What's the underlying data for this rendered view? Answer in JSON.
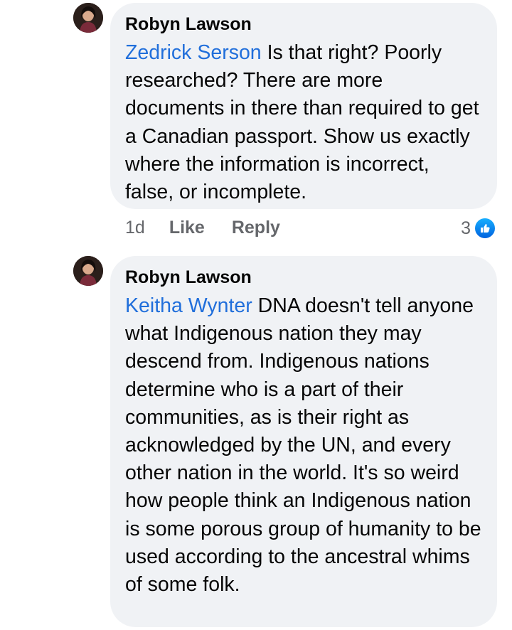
{
  "comments": [
    {
      "author": "Robyn Lawson",
      "mention": "Zedrick Serson",
      "text": " Is that right? Poorly researched? There are more documents in there than required to get a Canadian passport. Show us exactly where the information is incorrect, false, or incomplete.",
      "time": "1d",
      "like_label": "Like",
      "reply_label": "Reply",
      "reaction_count": "3"
    },
    {
      "author": "Robyn Lawson",
      "mention": "Keitha Wynter",
      "text": " DNA doesn't tell anyone what Indigenous nation they may descend from. Indigenous nations determine who is a part of their communities, as is their right as acknowledged by the UN, and every other nation in the world. It's so weird how people think an Indigenous nation is some porous group of humanity to be used according to the ancestral whims of some folk."
    }
  ],
  "colors": {
    "mention": "#216fdb",
    "bubble": "#f0f2f5",
    "like_blue": "#1877f2"
  },
  "icons": {
    "avatar": "avatar",
    "reaction": "like-thumb-icon"
  }
}
